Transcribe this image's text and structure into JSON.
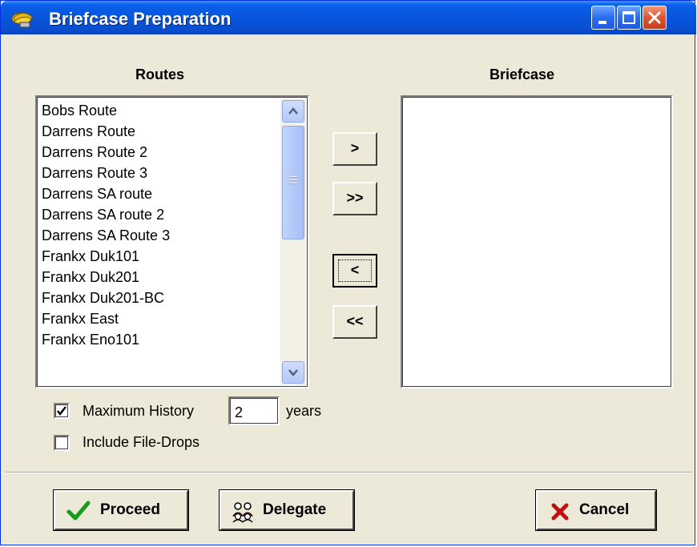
{
  "window": {
    "title": "Briefcase Preparation",
    "controls": [
      "minimize",
      "maximize",
      "close"
    ]
  },
  "routes": {
    "heading": "Routes",
    "items": [
      "Bobs Route",
      "Darrens Route",
      "Darrens Route 2",
      "Darrens Route 3",
      "Darrens SA route",
      "Darrens SA route 2",
      "Darrens SA Route 3",
      "Frankx Duk101",
      "Frankx Duk201",
      "Frankx Duk201-BC",
      "Frankx East",
      "Frankx Eno101"
    ]
  },
  "briefcase": {
    "heading": "Briefcase",
    "items": []
  },
  "move_buttons": {
    "add_one": ">",
    "add_all": ">>",
    "remove_one": "<",
    "remove_all": "<<"
  },
  "options": {
    "max_history_label": "Maximum History",
    "max_history_checked": true,
    "max_history_value": "2",
    "max_history_unit": "years",
    "include_file_drops_label": "Include File-Drops",
    "include_file_drops_checked": false
  },
  "actions": {
    "proceed": "Proceed",
    "delegate": "Delegate",
    "cancel": "Cancel"
  },
  "colors": {
    "titlebar": "#0855dd",
    "dialog_bg": "#ece9d8",
    "scrollbar": "#b6caf7",
    "proceed_check": "#1a9a1a",
    "cancel_x": "#c01010"
  },
  "icons": [
    "briefcase-app-icon",
    "checkmark-icon",
    "delegate-people-icon",
    "cancel-x-icon",
    "arrow-up-icon",
    "arrow-down-icon"
  ]
}
